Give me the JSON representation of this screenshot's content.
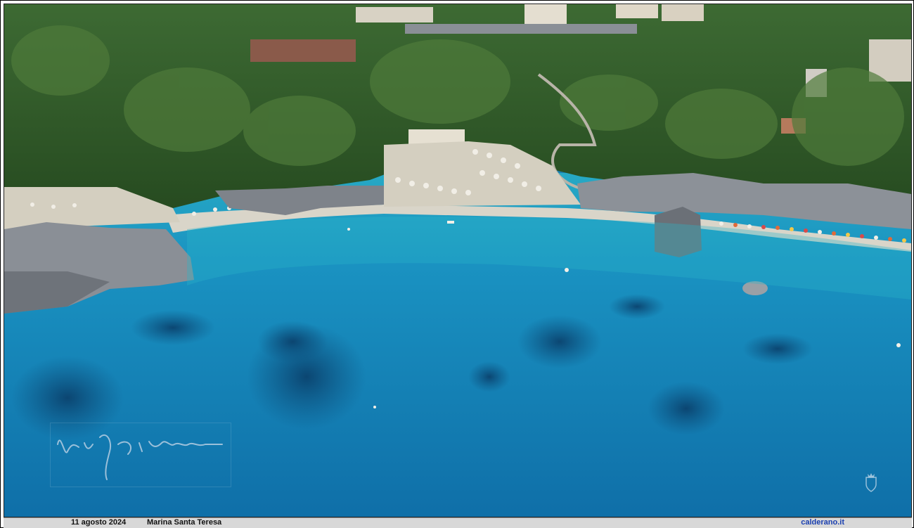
{
  "image": {
    "subject": "aerial coastal beach photo",
    "palette": {
      "sea_deep": "#0f6fa8",
      "sea_mid": "#1a8fc0",
      "sea_shallow": "#27a9c4",
      "reef": "#0d4f7d",
      "vegetation": "#2f5a2a",
      "vegetation_light": "#4f7a3a",
      "rock": "#8a8f96",
      "sand": "#d9d5c9",
      "umbrella": "#f1eee6"
    }
  },
  "caption": {
    "date": "11 agosto 2024",
    "place": "Marina Santa Teresa",
    "site": "calderano.it"
  },
  "icons": {
    "signature": "handwritten-signature-watermark",
    "crest": "crest-icon"
  }
}
